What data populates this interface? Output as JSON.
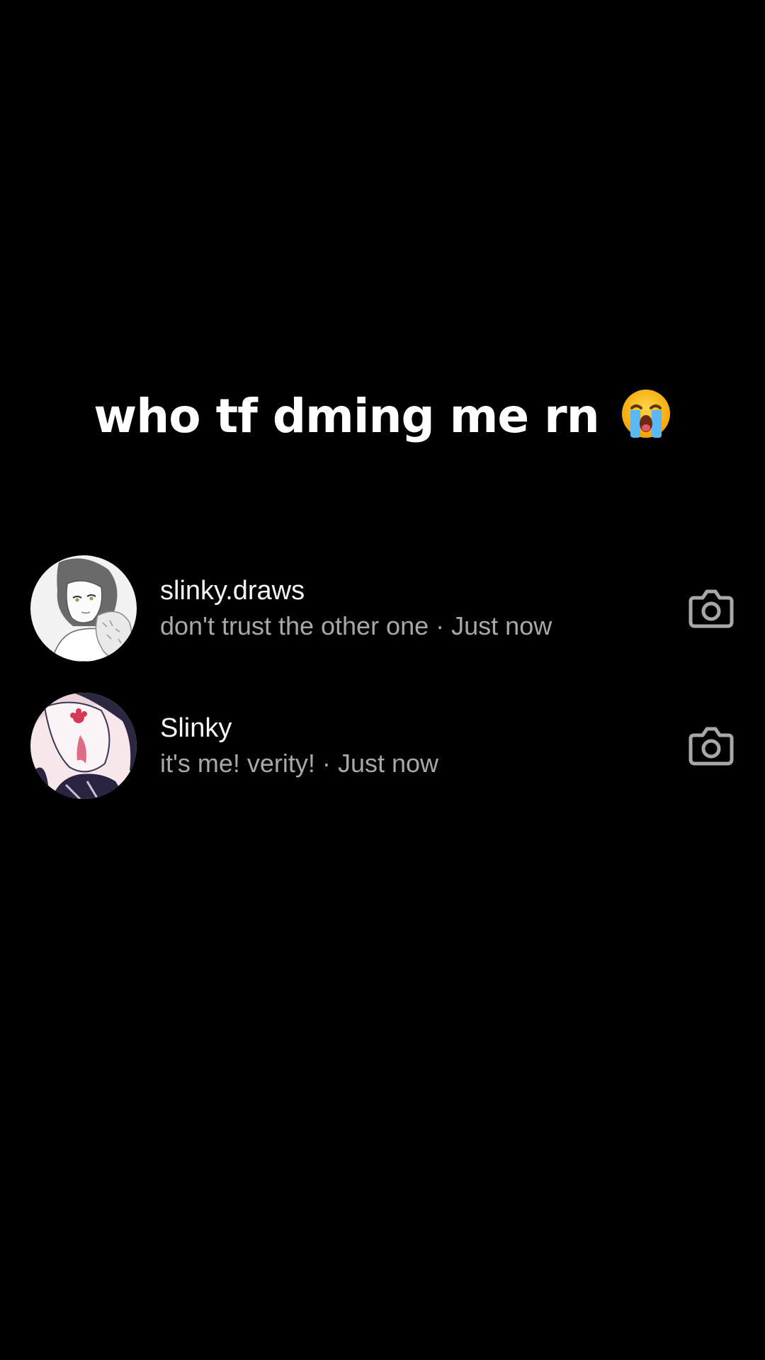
{
  "caption": {
    "text": "who tf dming me rn",
    "emoji": "loudly-crying-face-emoji"
  },
  "dm_list": [
    {
      "name": "slinky.draws",
      "message": "don't trust the other one",
      "separator": "·",
      "time": "Just now",
      "action_icon": "camera-icon"
    },
    {
      "name": "Slinky",
      "message": "it's me! verity!",
      "separator": "·",
      "time": "Just now",
      "action_icon": "camera-icon"
    }
  ],
  "colors": {
    "background": "#000000",
    "primary_text": "#f5f5f5",
    "secondary_text": "#a8a8a8",
    "icon": "#a8a8a8"
  }
}
